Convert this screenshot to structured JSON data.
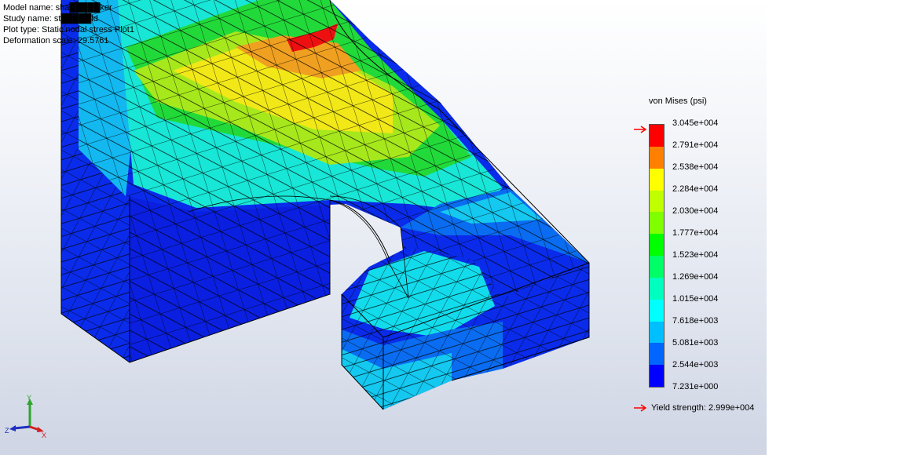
{
  "info": {
    "model_name_label": "Model name",
    "model_name_value": "sha█████ker",
    "study_name_label": "Study name",
    "study_name_value": "st█████ld",
    "plot_type_label": "Plot type",
    "plot_type_value": "Static nodal stress Plot1",
    "deformation_label": "Deformation scale",
    "deformation_value": "29.5761"
  },
  "legend": {
    "title": "von Mises (psi)",
    "ticks": [
      "3.045e+004",
      "2.791e+004",
      "2.538e+004",
      "2.284e+004",
      "2.030e+004",
      "1.777e+004",
      "1.523e+004",
      "1.269e+004",
      "1.015e+004",
      "7.618e+003",
      "5.081e+003",
      "2.544e+003",
      "7.231e+000"
    ],
    "band_colors": [
      "#ff0000",
      "#ff7f00",
      "#ffff00",
      "#bfff00",
      "#7fff00",
      "#00ff00",
      "#00ff66",
      "#00ffbf",
      "#00ffff",
      "#00bfff",
      "#0066ff",
      "#0000ff"
    ],
    "yield_label": "Yield strength: 2.999e+004",
    "yield_color": "#ff0000"
  },
  "triad": {
    "y": "Y",
    "z": "Z",
    "x": "X"
  }
}
